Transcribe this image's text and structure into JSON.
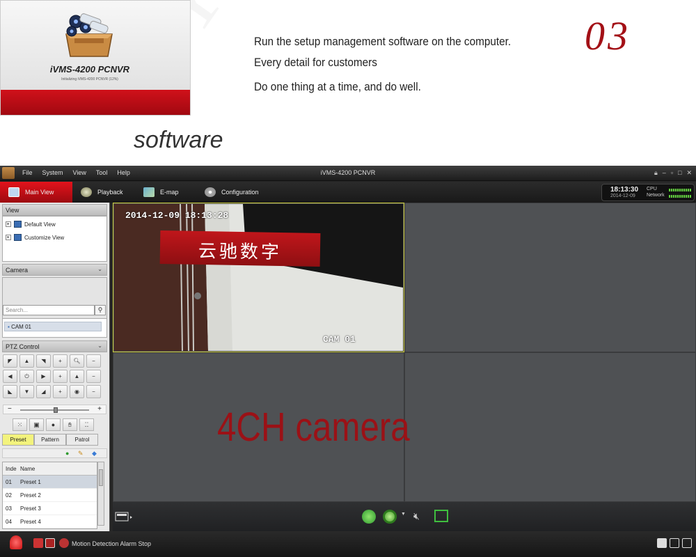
{
  "banner": {
    "splash_brand": "iVMS-4200 PCNVR",
    "splash_init": "Initializing iVMS-4200 PCNVR (12%)",
    "line1": "Run the setup management software on the computer.",
    "line2": "Every detail for customers",
    "line3": "Do one thing at a time, and do well.",
    "step": "03",
    "software_label": "software",
    "watermark": "YUNCHI"
  },
  "window": {
    "title": "iVMS-4200 PCNVR",
    "menu": [
      "File",
      "System",
      "View",
      "Tool",
      "Help"
    ]
  },
  "tabs": [
    {
      "label": "Main View",
      "icon": "monitor-icon",
      "active": true
    },
    {
      "label": "Playback",
      "icon": "playback-icon"
    },
    {
      "label": "E-map",
      "icon": "map-icon"
    },
    {
      "label": "Configuration",
      "icon": "gear-icon"
    }
  ],
  "clock": {
    "time": "18:13:30",
    "date": "2014-12-09",
    "cpu_label": "CPU",
    "network_label": "Network"
  },
  "left_panel": {
    "view_header": "View",
    "views": [
      "Default View",
      "Customize View"
    ],
    "camera_header": "Camera",
    "search_placeholder": "Search...",
    "cameras": [
      "CAM 01"
    ],
    "ptz_header": "PTZ Control",
    "ptz_tabs": [
      "Preset",
      "Pattern",
      "Patrol"
    ],
    "preset_columns": [
      "Inde",
      "Name"
    ],
    "presets": [
      {
        "index": "01",
        "name": "Preset 1"
      },
      {
        "index": "02",
        "name": "Preset 2"
      },
      {
        "index": "03",
        "name": "Preset 3"
      },
      {
        "index": "04",
        "name": "Preset 4"
      }
    ]
  },
  "video": {
    "osd_datetime": "2014-12-09  18:13:28",
    "osd_camera": "CAM 01",
    "sign_text": "云驰数字",
    "overlay_label": "4CH camera"
  },
  "status": {
    "alarm_text": "Motion Detection Alarm Stop"
  }
}
